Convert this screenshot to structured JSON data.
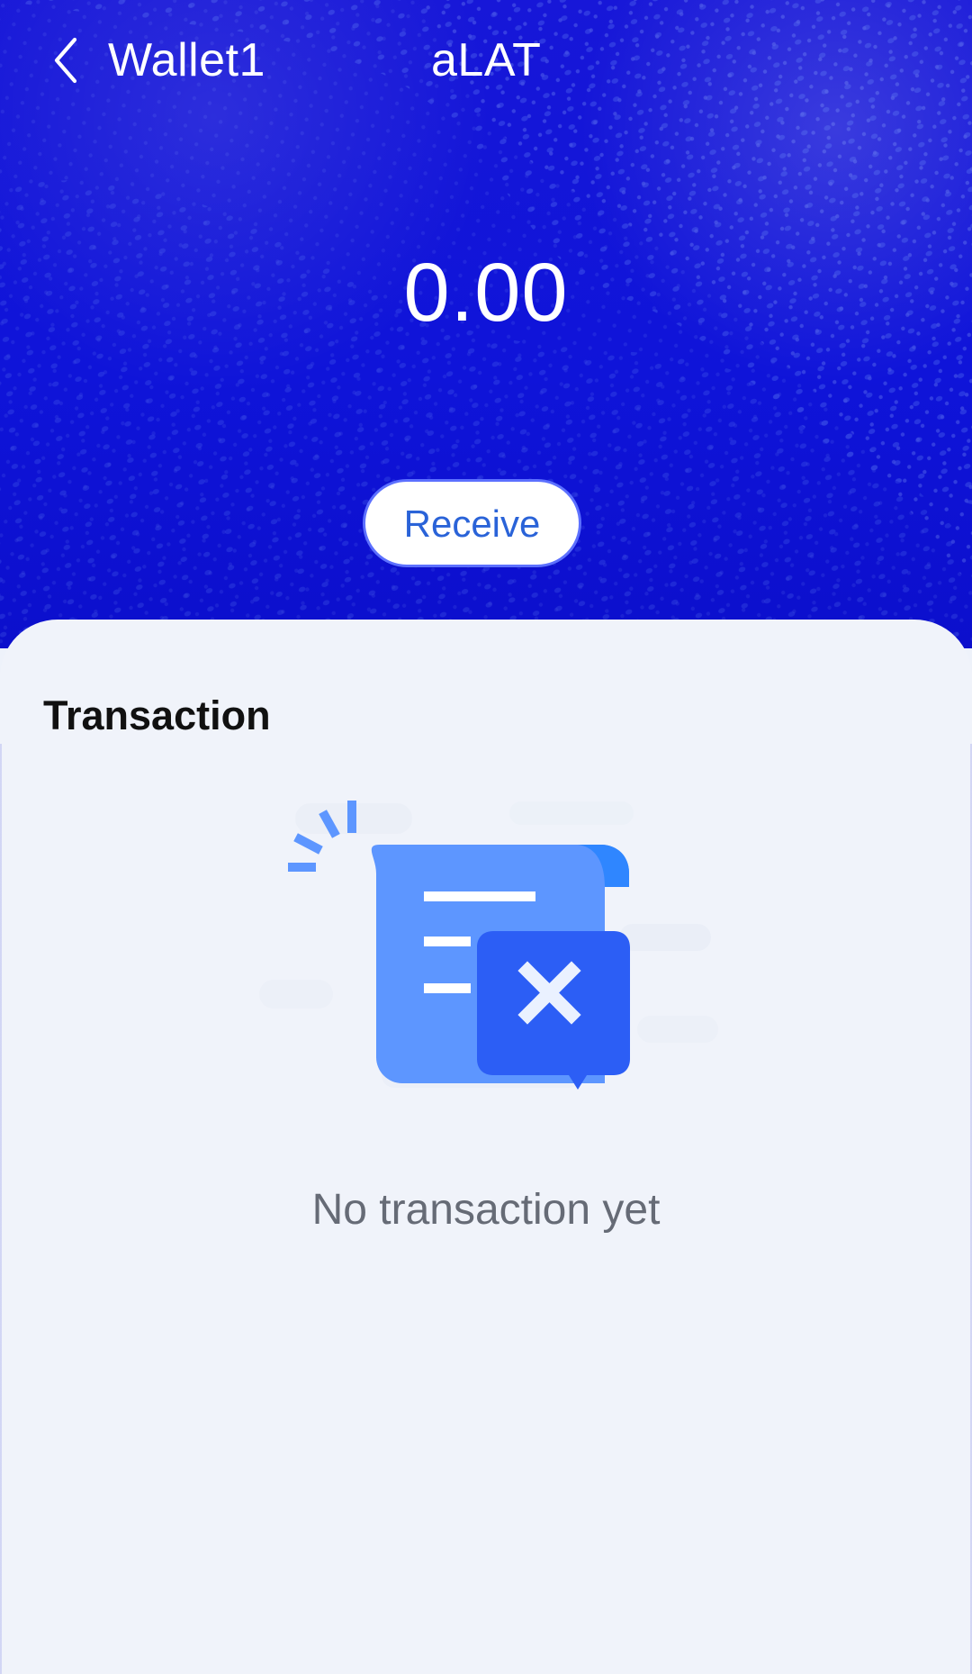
{
  "header": {
    "back_icon": "chevron-left-icon",
    "wallet_name": "Wallet1",
    "app_title": "aLAT"
  },
  "wallet": {
    "balance": "0.00",
    "receive_label": "Receive"
  },
  "transactions": {
    "title": "Transaction",
    "empty_icon": "empty-receipt-icon",
    "empty_message": "No transaction yet"
  },
  "colors": {
    "hero_blue": "#0f14d9",
    "button_text_blue": "#2a63d8",
    "card_background": "#f0f3fa",
    "receipt_blue": "#5d96ff",
    "alert_blue": "#2c5ef5"
  }
}
